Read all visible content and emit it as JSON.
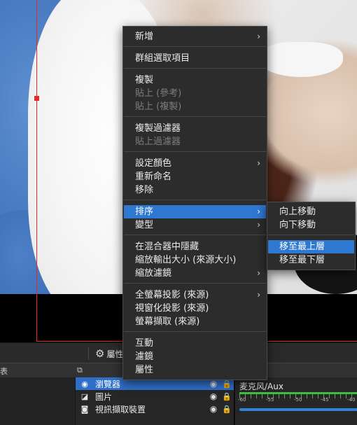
{
  "context_menu": {
    "new": "新增",
    "group_selected": "群組選取項目",
    "copy": "複製",
    "paste_ref": "貼上 (參考)",
    "paste_dup": "貼上 (複製)",
    "copy_filters": "複製過濾器",
    "paste_filters": "貼上過濾器",
    "set_color": "設定顏色",
    "rename": "重新命名",
    "remove": "移除",
    "order": "排序",
    "transform": "變型",
    "hide_in_mixer": "在混合器中隱藏",
    "resize_output": "縮放輸出大小 (來源大小)",
    "scale_filter": "縮放濾鏡",
    "fullscreen_projector": "全螢幕投影 (來源)",
    "windowed_projector": "視窗化投影 (來源)",
    "screenshot": "螢幕擷取 (來源)",
    "interact": "互動",
    "filters": "濾鏡",
    "properties": "屬性",
    "arrow": "›"
  },
  "order_submenu": {
    "move_up": "向上移動",
    "move_down": "向下移動",
    "move_top": "移至最上層",
    "move_bottom": "移至最下層"
  },
  "toolbar": {
    "properties_label": "屬性"
  },
  "dock_header": {
    "left_cut": "表",
    "scene_icon_glyph": "⧉"
  },
  "sources": [
    {
      "name": "瀏覽器",
      "icon": "globe-icon",
      "glyph": "◉",
      "selected": true
    },
    {
      "name": "圖片",
      "icon": "image-icon",
      "glyph": "◪",
      "selected": false
    },
    {
      "name": "視訊擷取裝置",
      "icon": "camera-icon",
      "glyph": "◙",
      "selected": false
    }
  ],
  "icons": {
    "eye": "◉",
    "lock": "🔒",
    "gear": "⚙"
  },
  "mixer": {
    "name": "麦克风/Aux",
    "db_ticks": [
      "-60",
      "-55",
      "-50",
      "-45",
      "-40"
    ]
  },
  "colors": {
    "accent": "#2e78d1",
    "guide": "#e32b2b",
    "meter": "#3fbf3f"
  }
}
